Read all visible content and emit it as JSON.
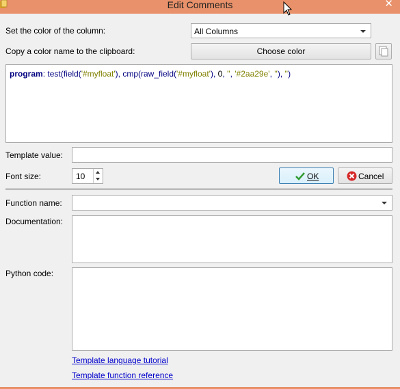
{
  "window": {
    "title": "Edit Comments"
  },
  "form": {
    "color_column_label": "Set the color of the column:",
    "color_column_value": "All Columns",
    "copy_color_label": "Copy a color name to the clipboard:",
    "choose_color_button": "Choose color",
    "template_value_label": "Template value:",
    "template_value": "",
    "font_size_label": "Font size:",
    "font_size_value": "10",
    "ok_button": "OK",
    "cancel_button": "Cancel",
    "function_name_label": "Function name:",
    "function_name_value": "",
    "documentation_label": "Documentation:",
    "python_code_label": "Python code:",
    "tutorial_link": "Template language tutorial",
    "reference_link": "Template function reference"
  },
  "program": {
    "keyword": "program",
    "sep": ": ",
    "t1": "test(field(",
    "s1": "'#myfloat'",
    "t2": "), cmp(raw_field(",
    "s2": "'#myfloat'",
    "t3": "), ",
    "n1": "0",
    "t4": ", ",
    "s3": "''",
    "t5": ", ",
    "s4": "'#2aa29e'",
    "t6": ", ",
    "s5": "''",
    "t7": "), ",
    "s6": "''",
    "t8": ")"
  },
  "colors": {
    "titlebar": "#e8916a",
    "dialog_bg": "#f0f0f0",
    "link": "#0000cc",
    "ok_check": "#2e9b2e",
    "cancel_icon": "#d62828"
  },
  "icons": {
    "title_icon": "app-icon",
    "close": "close-icon",
    "ok": "checkmark-icon",
    "cancel": "cancel-circle-icon",
    "copy": "copy-icon",
    "dropdown": "chevron-down-icon",
    "cursor": "mouse-cursor-icon"
  }
}
